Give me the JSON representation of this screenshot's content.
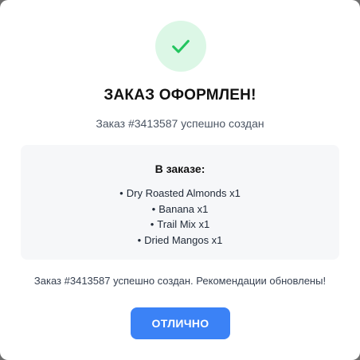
{
  "background": {
    "fragments": [
      "...",
      "...",
      "..."
    ]
  },
  "modal": {
    "icon": "check-icon",
    "accent_color": "#22c55e",
    "title": "ЗАКАЗ ОФОРМЛЕН!",
    "subtitle": "Заказ #3413587 успешно создан",
    "order": {
      "heading": "В заказе:",
      "items": [
        "Dry Roasted Almonds x1",
        "Banana x1",
        "Trail Mix x1",
        "Dried Mangos x1"
      ]
    },
    "message": "Заказ #3413587 успешно создан. Рекомендации обновлены!",
    "ok_label": "ОТЛИЧНО",
    "button_color": "#3b82f6"
  }
}
